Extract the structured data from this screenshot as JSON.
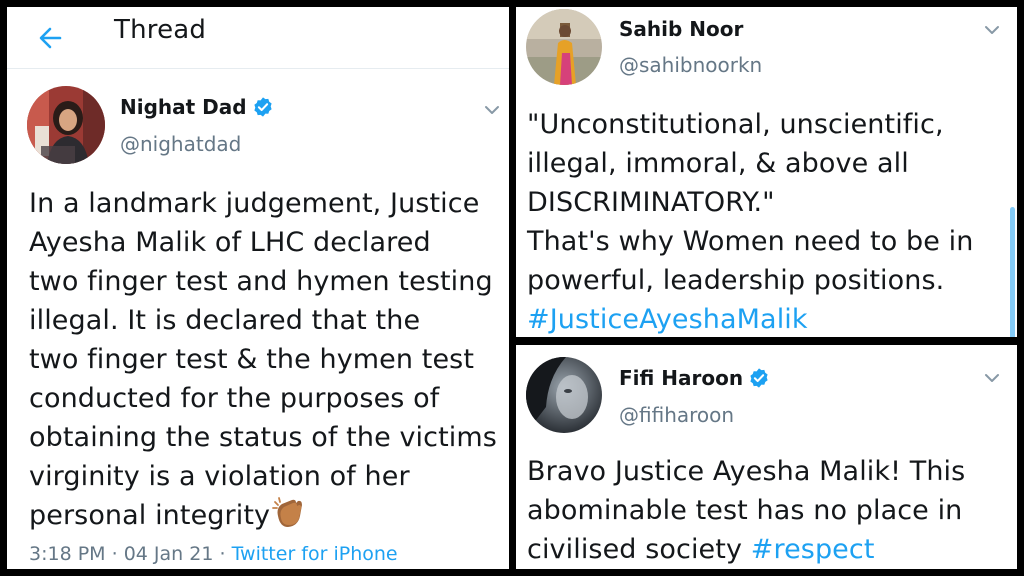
{
  "header": {
    "title": "Thread",
    "back_icon": "arrow-left-icon"
  },
  "main_tweet": {
    "name": "Nighat Dad",
    "handle": "@nighatdad",
    "verified": true,
    "lines": [
      "In a landmark judgement, Justice",
      "Ayesha Malik of LHC declared",
      "two finger test and hymen testing",
      "illegal. It is declared that the",
      "two finger test & the hymen test",
      "conducted for the purposes of",
      "obtaining the status of the victims",
      "virginity is a violation of her",
      "personal integrity"
    ],
    "emoji": "clapping-hands-icon",
    "time": "3:18 PM",
    "date": "04 Jan 21",
    "source": "Twitter for iPhone"
  },
  "tweet_2": {
    "name": "Sahib Noor",
    "handle": "@sahibnoorkn",
    "verified": false,
    "lines": [
      "\"Unconstitutional, unscientific,",
      "illegal, immoral, & above all",
      "DISCRIMINATORY.\"",
      "That's why Women need to be in",
      "powerful, leadership positions."
    ],
    "hashtag": "#JusticeAyeshaMalik"
  },
  "tweet_3": {
    "name": "Fifi Haroon",
    "handle": "@fifiharoon",
    "verified": true,
    "lines": [
      "Bravo Justice Ayesha Malik! This",
      "abominable test has no place in",
      "civilised society"
    ],
    "hashtag": "#respect"
  },
  "colors": {
    "accent": "#1da1f2",
    "text": "#14171a",
    "muted": "#657786",
    "divider": "#000000"
  }
}
